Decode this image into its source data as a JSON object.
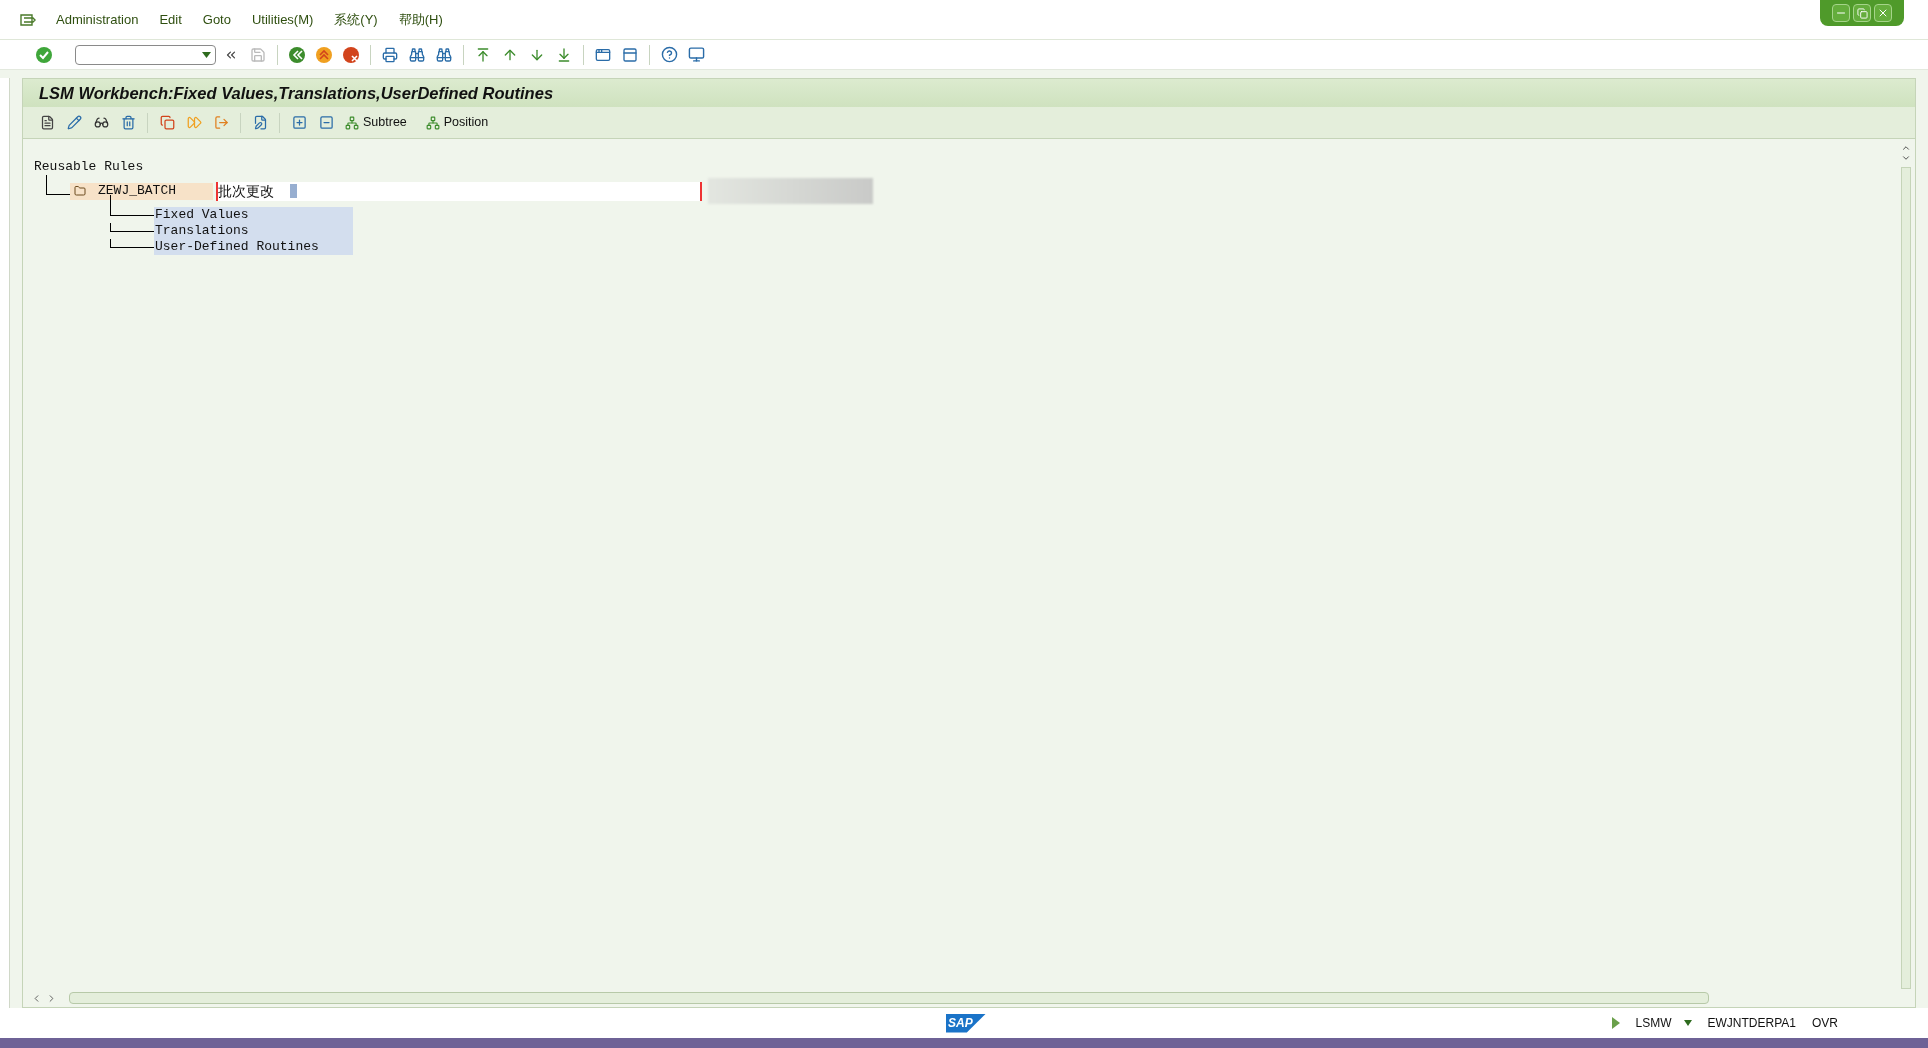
{
  "menu_bar": [
    "Administration",
    "Edit",
    "Goto",
    "Utilities(M)",
    "系统(Y)",
    "帮助(H)"
  ],
  "screen_title": "LSM Workbench:Fixed Values,Translations,UserDefined Routines",
  "app_toolbar": {
    "text_buttons": [
      "Subtree",
      "Position"
    ]
  },
  "tree": {
    "label": "Reusable Rules",
    "children": [
      {
        "name": "ZEWJ_BATCH",
        "description": "批次更改",
        "children": [
          {
            "label": "Fixed Values"
          },
          {
            "label": "Translations"
          },
          {
            "label": "User-Defined Routines"
          }
        ]
      }
    ]
  },
  "logo": "SAP",
  "status_bar": {
    "transaction": "LSMW",
    "system": "EWJNTDERPA1",
    "mode": "OVR"
  }
}
